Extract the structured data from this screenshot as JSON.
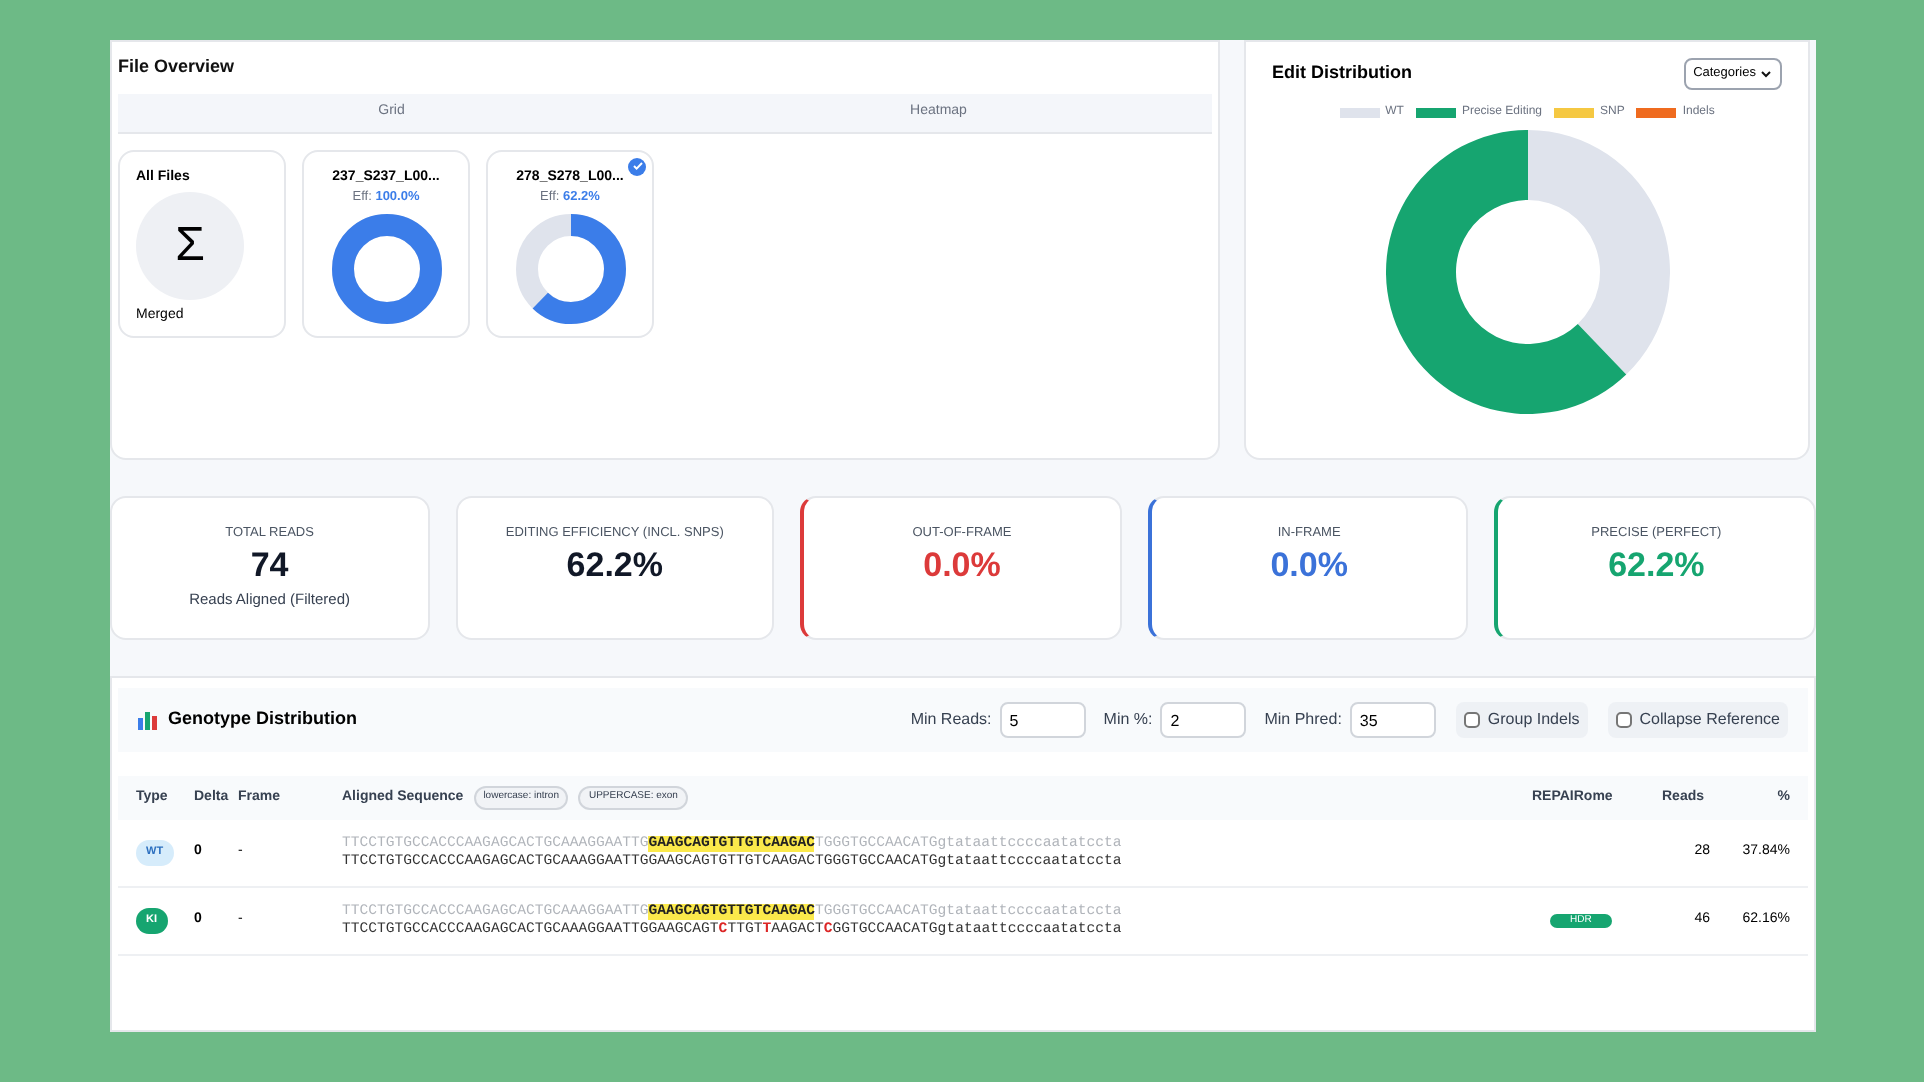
{
  "file_overview": {
    "title": "File Overview",
    "tabs": [
      {
        "label": "Grid"
      },
      {
        "label": "Heatmap"
      }
    ],
    "merged": {
      "title": "All Files",
      "symbol": "Σ",
      "caption": "Merged"
    },
    "files": [
      {
        "name": "237_S237_L00...",
        "eff_label": "Eff:",
        "eff_value": "100.0%",
        "level": 1.0,
        "selected": false
      },
      {
        "name": "278_S278_L00...",
        "eff_label": "Eff:",
        "eff_value": "62.2%",
        "level": 0.622,
        "selected": true
      }
    ]
  },
  "edit_distribution": {
    "title": "Edit Distribution",
    "dropdown": "Categories",
    "chart_data": {
      "type": "donut",
      "categories": [
        "WT",
        "Precise Editing",
        "SNP",
        "Indels"
      ],
      "values": [
        37.84,
        62.16,
        0,
        0
      ],
      "colors": [
        "#dfe3ec",
        "#16a570",
        "#f5c842",
        "#ef6b1f"
      ]
    }
  },
  "stats": [
    {
      "label": "TOTAL READS",
      "value": "74",
      "sub": "Reads Aligned (Filtered)",
      "kind": "plain",
      "color": "#111827"
    },
    {
      "label": "EDITING EFFICIENCY (INCL. SNPS)",
      "value": "62.2%",
      "kind": "plain",
      "color": "#111827"
    },
    {
      "label": "OUT-OF-FRAME",
      "value": "0.0%",
      "kind": "accent",
      "color": "#dc3a3a"
    },
    {
      "label": "IN-FRAME",
      "value": "0.0%",
      "kind": "accent",
      "color": "#3b72d9"
    },
    {
      "label": "PRECISE (PERFECT)",
      "value": "62.2%",
      "kind": "accent",
      "color": "#16a570"
    }
  ],
  "genotype": {
    "title": "Genotype Distribution",
    "filters": [
      {
        "label": "Min Reads:",
        "value": "5"
      },
      {
        "label": "Min %:",
        "value": "2"
      },
      {
        "label": "Min Phred:",
        "value": "35"
      }
    ],
    "toggles": [
      {
        "label": "Group Indels",
        "checked": false
      },
      {
        "label": "Collapse Reference",
        "checked": false
      }
    ],
    "columns": [
      "Type",
      "Delta",
      "Frame",
      "Aligned Sequence",
      "REPAIRome",
      "Reads",
      "%"
    ],
    "legend_tags": [
      "lowercase: intron",
      "UPPERCASE: exon"
    ],
    "rows": [
      {
        "type": "WT",
        "color": "#d6ecfb",
        "kind": "light",
        "delta": "0",
        "frame": "-",
        "ref": [
          "TTCCTGTGCCACCCAAGAGCACTGCAAAGGAATTG",
          "GAAGCAGTGTTGTCAAGAC",
          "TGGGTGCCAACATGgtataattccccaatatccta"
        ],
        "read": [
          {
            "text": "TTCCTGTGCCACCCAAGAGCACTGCAAAGGAATTGGAAGCAGTGTTGTCAAGACTGGGTGCCAACATGgtataattccccaatatccta",
            "mutated": false
          }
        ],
        "repair": "",
        "reads": "28",
        "pct": "37.84%"
      },
      {
        "type": "KI",
        "color": "#16a570",
        "kind": "solid",
        "delta": "0",
        "frame": "-",
        "ref": [
          "TTCCTGTGCCACCCAAGAGCACTGCAAAGGAATTG",
          "GAAGCAGTGTTGTCAAGAC",
          "TGGGTGCCAACATGgtataattccccaatatccta"
        ],
        "read": [
          {
            "text": "TTCCTGTGCCACCCAAGAGCACTGCAAAGGAATTGGAAGCAGT",
            "mutated": false
          },
          {
            "text": "C",
            "mutated": true
          },
          {
            "text": "TTGT",
            "mutated": false
          },
          {
            "text": "T",
            "mutated": true
          },
          {
            "text": "AAGACT",
            "mutated": false
          },
          {
            "text": "C",
            "mutated": true
          },
          {
            "text": "GGTGCCAACATGgtataattccccaatatccta",
            "mutated": false
          }
        ],
        "repair": "HDR",
        "reads": "46",
        "pct": "62.16%"
      }
    ]
  }
}
